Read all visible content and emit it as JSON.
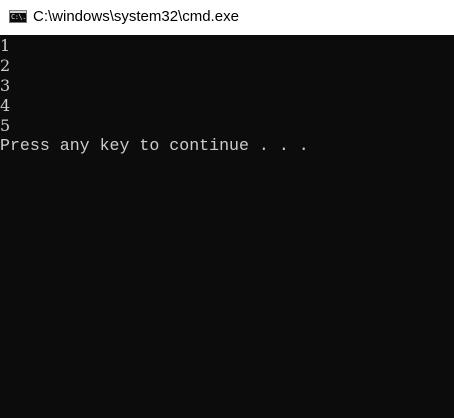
{
  "window": {
    "title": "C:\\windows\\system32\\cmd.exe",
    "icon": "cmd-icon",
    "icon_text": "C:\\."
  },
  "console": {
    "lines": [
      "1",
      "2",
      "3",
      "4",
      "5"
    ],
    "prompt": "Press any key to continue . . .",
    "background": "#0c0c0c",
    "foreground": "#cccccc"
  }
}
